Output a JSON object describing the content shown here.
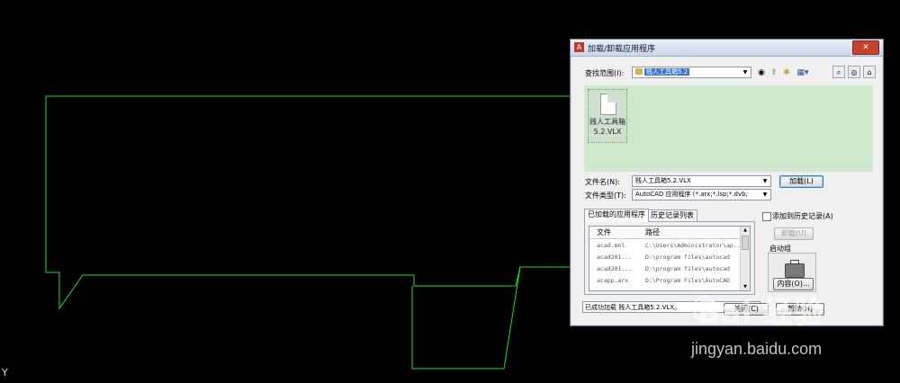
{
  "cad": {
    "ucs_label": "Y",
    "outline_color": "#22dd22"
  },
  "dialog": {
    "title": "加载/卸载应用程序",
    "close_label": "✕",
    "lookin_label": "查找范围(I):",
    "lookin_value": "贱人工具箱5.2",
    "files": [
      {
        "name_line1": "贱人工具箱",
        "name_line2": "5.2.VLX"
      }
    ],
    "filename_label": "文件名(N):",
    "filename_value": "贱人工具箱5.2.VLX",
    "filetype_label": "文件类型(T):",
    "filetype_value": "AutoCAD 应用程序 (*.arx;*.lsp;*.dvb;",
    "load_button": "加载(L)",
    "tabs": [
      "已加载的应用程序",
      "历史记录列表"
    ],
    "columns": [
      "文件",
      "路径"
    ],
    "rows": [
      {
        "file": "acad.mnl",
        "path": "C:\\Users\\Administrator\\ap..."
      },
      {
        "file": "acad201...",
        "path": "D:\\program files\\autocad"
      },
      {
        "file": "acad201...",
        "path": "D:\\program files\\autocad"
      },
      {
        "file": "acapp.arx",
        "path": "D:\\Program Files\\AutoCAD"
      }
    ],
    "history_checkbox": "添加到历史记录(A)",
    "unload_button": "卸载(U)",
    "startup_label": "启动组",
    "contents_button": "内容(O)...",
    "status_text": "已成功加载 贱人工具箱5.2.VLX。",
    "close_button": "关闭(C)",
    "help_button": "帮助(H)"
  },
  "watermark": {
    "brand": "Bai  经验",
    "url": "jingyan.baidu.com"
  }
}
